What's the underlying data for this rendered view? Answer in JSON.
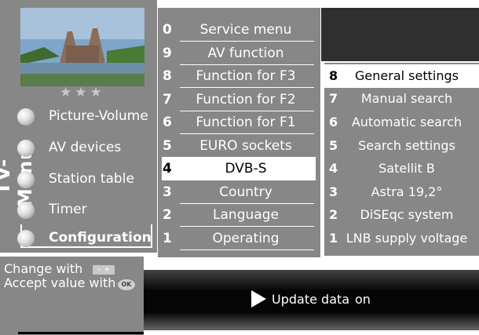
{
  "side_title": "TV-Menu",
  "rating_stars": "★★★",
  "left_menu": {
    "items": [
      {
        "label": "Picture-Volume"
      },
      {
        "label": "AV devices"
      },
      {
        "label": "Station table"
      },
      {
        "label": "Timer"
      },
      {
        "label": "Configuration",
        "selected": true
      }
    ]
  },
  "middle_menu": {
    "items": [
      {
        "num": "0",
        "label": "Service menu"
      },
      {
        "num": "9",
        "label": "AV function"
      },
      {
        "num": "8",
        "label": "Function for F3"
      },
      {
        "num": "7",
        "label": "Function for F2"
      },
      {
        "num": "6",
        "label": "Function for F1"
      },
      {
        "num": "5",
        "label": "EURO sockets"
      },
      {
        "num": "4",
        "label": "DVB-S",
        "selected": true
      },
      {
        "num": "3",
        "label": "Country"
      },
      {
        "num": "2",
        "label": "Language"
      },
      {
        "num": "1",
        "label": "Operating"
      }
    ]
  },
  "right_menu": {
    "items": [
      {
        "num": "8",
        "label": "General settings",
        "selected": true
      },
      {
        "num": "7",
        "label": "Manual search"
      },
      {
        "num": "6",
        "label": "Automatic search"
      },
      {
        "num": "5",
        "label": "Search settings"
      },
      {
        "num": "4",
        "label": "Satellit B"
      },
      {
        "num": "3",
        "label": "Astra 19,2°"
      },
      {
        "num": "2",
        "label": "DiSEqc system"
      },
      {
        "num": "1",
        "label": "LNB supply voltage"
      }
    ]
  },
  "help": {
    "line1": "Change with",
    "line2": "Accept value with",
    "minus_plus": "–  +",
    "ok": "OK"
  },
  "info": {
    "label": "Update data",
    "value": "on"
  },
  "colors": {
    "panel_gray": "#878787",
    "dark": "#2f2f2f"
  }
}
